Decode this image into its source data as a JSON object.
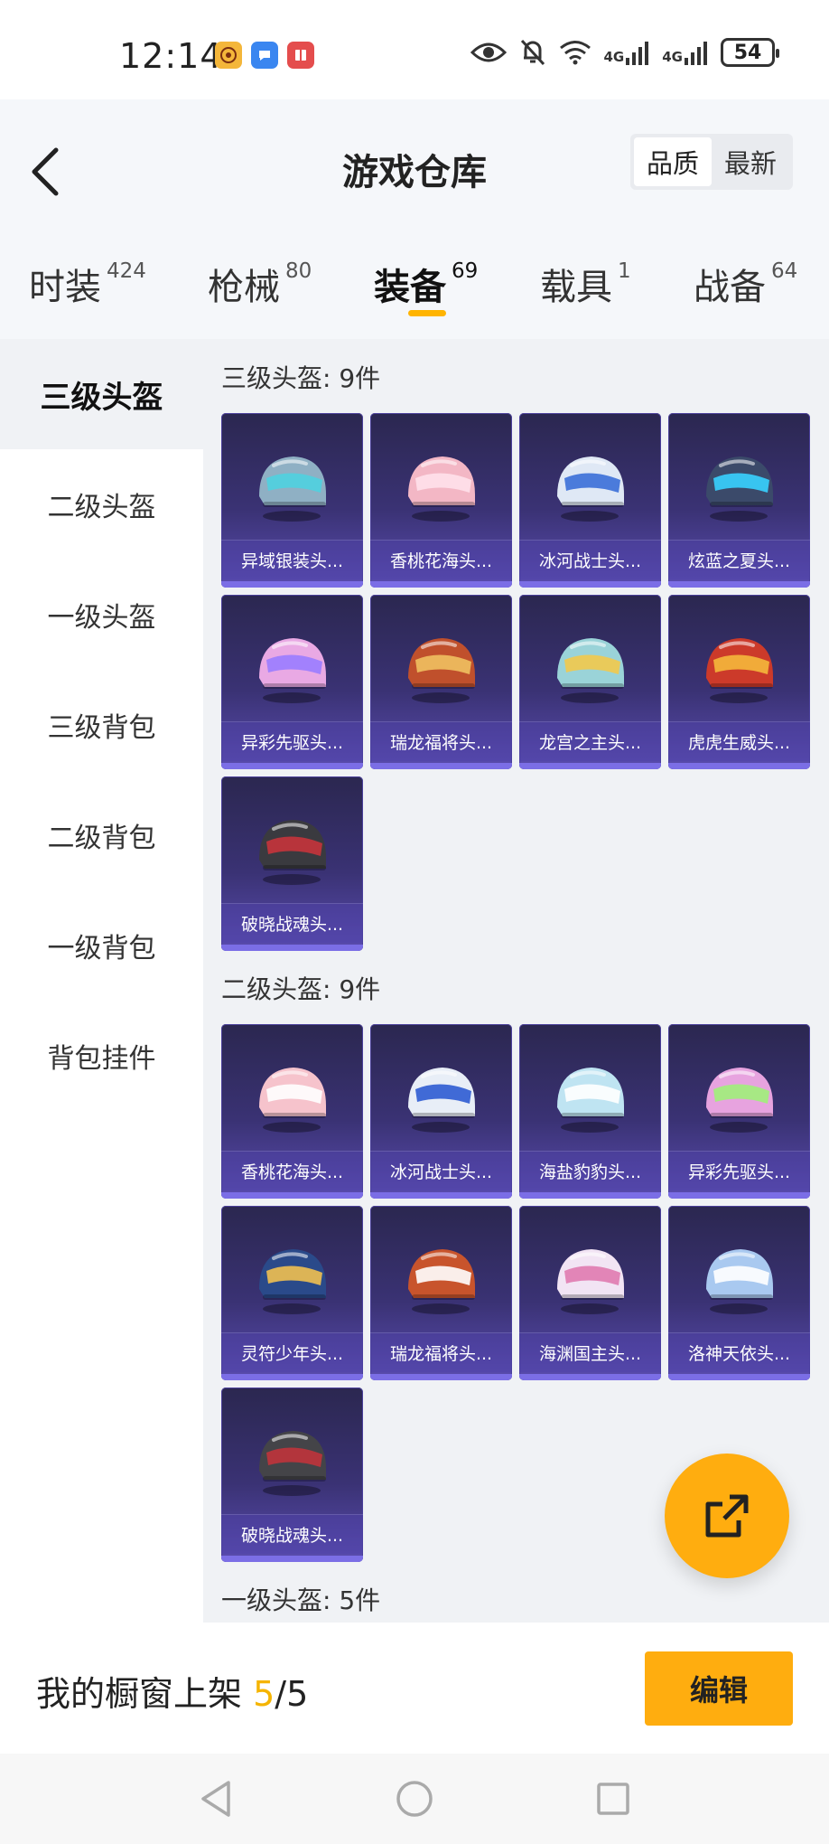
{
  "status_bar": {
    "time": "12:14",
    "battery": "54",
    "network_1": "4G",
    "network_2": "4G"
  },
  "header": {
    "title": "游戏仓库",
    "sort_options": [
      "品质",
      "最新"
    ],
    "active_sort": "品质"
  },
  "categories": [
    {
      "label": "时装",
      "count": "424"
    },
    {
      "label": "枪械",
      "count": "80"
    },
    {
      "label": "装备",
      "count": "69"
    },
    {
      "label": "载具",
      "count": "1"
    },
    {
      "label": "战备",
      "count": "64"
    }
  ],
  "active_category": "装备",
  "sidebar": {
    "items": [
      "三级头盔",
      "二级头盔",
      "一级头盔",
      "三级背包",
      "二级背包",
      "一级背包",
      "背包挂件"
    ],
    "active": "三级头盔"
  },
  "sections": [
    {
      "title": "三级头盔: 9件",
      "items": [
        {
          "name": "异域银装头...",
          "color": "#8fb0c4",
          "accent": "#4fd1e0"
        },
        {
          "name": "香桃花海头...",
          "color": "#f3b7c5",
          "accent": "#ffe1ea"
        },
        {
          "name": "冰河战士头...",
          "color": "#dfe8f5",
          "accent": "#3b6fd8"
        },
        {
          "name": "炫蓝之夏头...",
          "color": "#3b4a6a",
          "accent": "#38d2ff"
        },
        {
          "name": "异彩先驱头...",
          "color": "#e9a9e4",
          "accent": "#9a7cff"
        },
        {
          "name": "瑞龙福将头...",
          "color": "#c0502c",
          "accent": "#f0c060"
        },
        {
          "name": "龙宫之主头...",
          "color": "#9ad3d8",
          "accent": "#f2c94c"
        },
        {
          "name": "虎虎生威头...",
          "color": "#cc3a2a",
          "accent": "#f5b83b"
        },
        {
          "name": "破晓战魂头...",
          "color": "#3a3a3f",
          "accent": "#c7343b"
        }
      ]
    },
    {
      "title": "二级头盔: 9件",
      "items": [
        {
          "name": "香桃花海头...",
          "color": "#f6c3cc",
          "accent": "#ffffff"
        },
        {
          "name": "冰河战士头...",
          "color": "#e8eef7",
          "accent": "#2d5bd1"
        },
        {
          "name": "海盐豹豹头...",
          "color": "#bfe4f2",
          "accent": "#ffffff"
        },
        {
          "name": "异彩先驱头...",
          "color": "#e7a3df",
          "accent": "#a0f07a"
        },
        {
          "name": "灵符少年头...",
          "color": "#2a4a8a",
          "accent": "#f0c050"
        },
        {
          "name": "瑞龙福将头...",
          "color": "#c8542c",
          "accent": "#ffffff"
        },
        {
          "name": "海渊国主头...",
          "color": "#f2e4f4",
          "accent": "#e07ab0"
        },
        {
          "name": "洛神天依头...",
          "color": "#a9c9f0",
          "accent": "#ffffff"
        },
        {
          "name": "破晓战魂头...",
          "color": "#444448",
          "accent": "#c0343b"
        }
      ]
    },
    {
      "title": "一级头盔: 5件",
      "items": []
    }
  ],
  "bottom_bar": {
    "label": "我的橱窗上架 ",
    "current": "5",
    "separator": "/",
    "total": "5",
    "edit_label": "编辑"
  },
  "colors": {
    "accent": "#ffad0f",
    "underline": "#ffb400",
    "card_bg": "#3a3274"
  }
}
